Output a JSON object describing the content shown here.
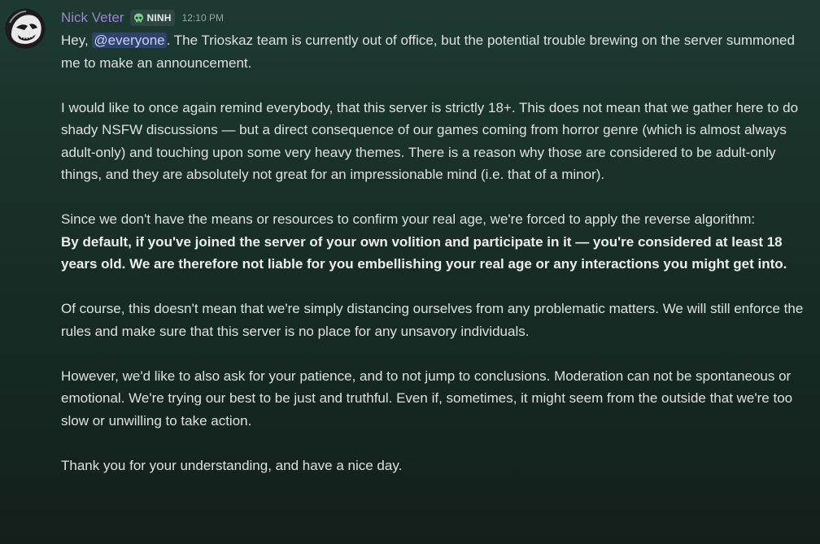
{
  "message": {
    "author": "Nick Veter",
    "tag": "NINH",
    "tag_icon": "skull-icon",
    "timestamp": "12:10 PM",
    "intro_before": "Hey, ",
    "mention": "@everyone",
    "intro_after": ". The Trioskaz team is currently out of office, but the potential trouble brewing on the server summoned me to make an announcement.",
    "p2": "I would like to once again remind everybody, that this server is strictly 18+. This does not mean that we gather here to do shady NSFW discussions — but a direct consequence of our games coming from horror genre (which is almost always adult-only) and touching upon some very heavy themes. There is a reason why those are considered to be adult-only things, and they are absolutely not great for an impressionable mind (i.e. that of a minor).",
    "p3": "Since we don't have the means or resources to confirm your real age, we're forced to apply the reverse algorithm:",
    "p3_bold": "By default, if you've joined the server of your own volition and participate in it — you're considered at least 18 years old. We are therefore not liable for you embellishing your real age or any interactions you might get into.",
    "p4": "Of course, this doesn't mean that we're simply distancing ourselves from any problematic matters. We will still enforce the rules and make sure that this server is no place for any unsavory individuals.",
    "p5": "However, we'd like to also ask for your patience, and to not jump to conclusions. Moderation can not be spontaneous or emotional. We're trying our best to be just and truthful. Even if, sometimes, it might seem from the outside that we're too slow or unwilling to take action.",
    "p6": "Thank you for your understanding, and have a nice day."
  },
  "colors": {
    "username": "#9b86c8",
    "mention_bg": "#5865f2",
    "background": "#193129"
  }
}
